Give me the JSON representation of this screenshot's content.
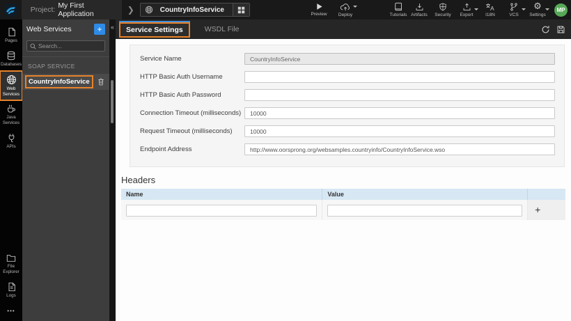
{
  "colors": {
    "accent_blue": "#2e8be6",
    "active_tab_indicator": "#3e8ede",
    "annotation_orange": "#e8832a",
    "avatar_green": "#57a957",
    "table_header_blue": "#d7e7f4"
  },
  "topbar": {
    "project_prefix": "Project:",
    "project_name": "My First Application",
    "service_tab_label": "CountryInfoService",
    "preview_label": "Preview",
    "deploy_label": "Deploy",
    "tutorials_label": "Tutorials",
    "artifacts_label": "Artifacts",
    "security_label": "Security",
    "export_label": "Export",
    "i18n_label": "I18N",
    "vcs_label": "VCS",
    "settings_label": "Settings",
    "avatar_initials": "MP"
  },
  "left_rail": {
    "items": [
      {
        "label": "Pages"
      },
      {
        "label": "Databases"
      },
      {
        "label": "Web Services"
      },
      {
        "label": "Java Services"
      },
      {
        "label": "APIs"
      }
    ],
    "bottom_items": [
      {
        "label": "File Explorer"
      },
      {
        "label": "Logs"
      }
    ],
    "more_glyph": "•••"
  },
  "panel": {
    "title": "Web Services",
    "add_button": "+",
    "collapse_glyph": "«",
    "search_placeholder": "Search...",
    "section_label": "SOAP SERVICE",
    "service_item": "CountryInfoService"
  },
  "main": {
    "tabs": [
      {
        "label": "Service Settings"
      },
      {
        "label": "WSDL File"
      }
    ],
    "form": {
      "fields": [
        {
          "label": "Service Name",
          "value": "CountryInfoService"
        },
        {
          "label": "HTTP Basic Auth Username",
          "value": ""
        },
        {
          "label": "HTTP Basic Auth Password",
          "value": ""
        },
        {
          "label": "Connection Timeout (milliseconds)",
          "value": "10000"
        },
        {
          "label": "Request Timeout (milliseconds)",
          "value": "10000"
        },
        {
          "label": "Endpoint Address",
          "value": "http://www.oorsprong.org/websamples.countryinfo/CountryInfoService.wso"
        }
      ]
    },
    "headers": {
      "title": "Headers",
      "name_column": "Name",
      "value_column": "Value",
      "add_button": "+"
    }
  }
}
